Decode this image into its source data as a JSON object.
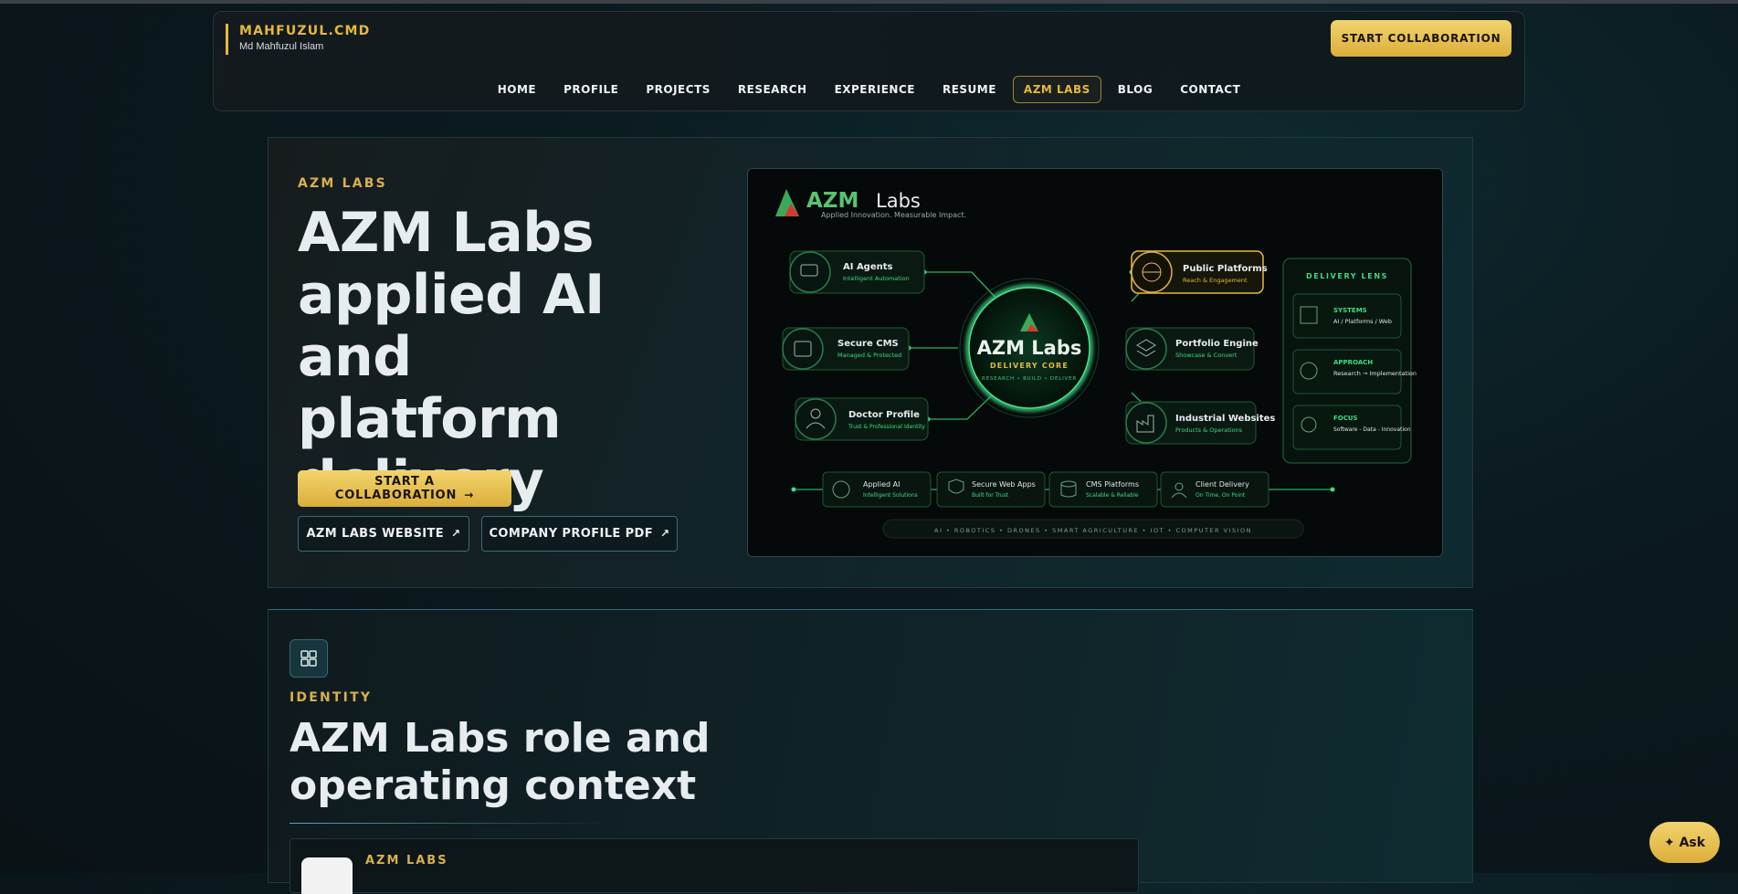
{
  "header": {
    "brand_title": "MAHFUZUL.CMD",
    "brand_subtitle": "Md Mahfuzul Islam",
    "cta_label": "START COLLABORATION",
    "nav": [
      "HOME",
      "PROFILE",
      "PROJECTS",
      "RESEARCH",
      "EXPERIENCE",
      "RESUME",
      "AZM LABS",
      "BLOG",
      "CONTACT"
    ],
    "active_nav": "AZM LABS"
  },
  "hero": {
    "eyebrow": "AZM LABS",
    "title": "AZM Labs applied AI and platform delivery",
    "primary_button": "START A COLLABORATION",
    "website_button": "AZM LABS WEBSITE",
    "pdf_button": "COMPANY PROFILE PDF"
  },
  "graphic": {
    "logo_bold": "AZM",
    "logo_light": "Labs",
    "tagline": "Applied Innovation. Measurable Impact.",
    "core_title": "AZM Labs",
    "core_sub": "DELIVERY CORE",
    "core_steps": "RESEARCH • BUILD • DELIVER",
    "nodes_left": [
      {
        "title": "AI Agents",
        "sub": "Intelligent Automation"
      },
      {
        "title": "Secure CMS",
        "sub": "Managed & Protected"
      },
      {
        "title": "Doctor Profile",
        "sub": "Trust & Professional Identity"
      }
    ],
    "nodes_right": [
      {
        "title": "Public Platforms",
        "sub": "Reach & Engagement"
      },
      {
        "title": "Portfolio Engine",
        "sub": "Showcase & Convert"
      },
      {
        "title": "Industrial Websites",
        "sub": "Products & Operations"
      }
    ],
    "lens_title": "DELIVERY LENS",
    "lens": [
      {
        "title": "SYSTEMS",
        "sub": "AI / Platforms / Web"
      },
      {
        "title": "APPROACH",
        "sub": "Research → Implementation"
      },
      {
        "title": "FOCUS",
        "sub": "Software - Data - Innovation"
      }
    ],
    "bottom": [
      {
        "title": "Applied AI",
        "sub": "Intelligent Solutions"
      },
      {
        "title": "Secure Web Apps",
        "sub": "Built for Trust"
      },
      {
        "title": "CMS Platforms",
        "sub": "Scalable & Reliable"
      },
      {
        "title": "Client Delivery",
        "sub": "On Time, On Point"
      }
    ],
    "strip": "AI  •  ROBOTICS  •  DRONES  •  SMART AGRICULTURE  •  IOT  •  COMPUTER VISION"
  },
  "identity": {
    "eyebrow": "IDENTITY",
    "title": "AZM Labs role and operating context",
    "card_label": "AZM LABS"
  },
  "ask_label": "Ask",
  "colors": {
    "accent": "#e5b93e",
    "neon": "#3ddc84",
    "bg": "#0b1a1f"
  }
}
